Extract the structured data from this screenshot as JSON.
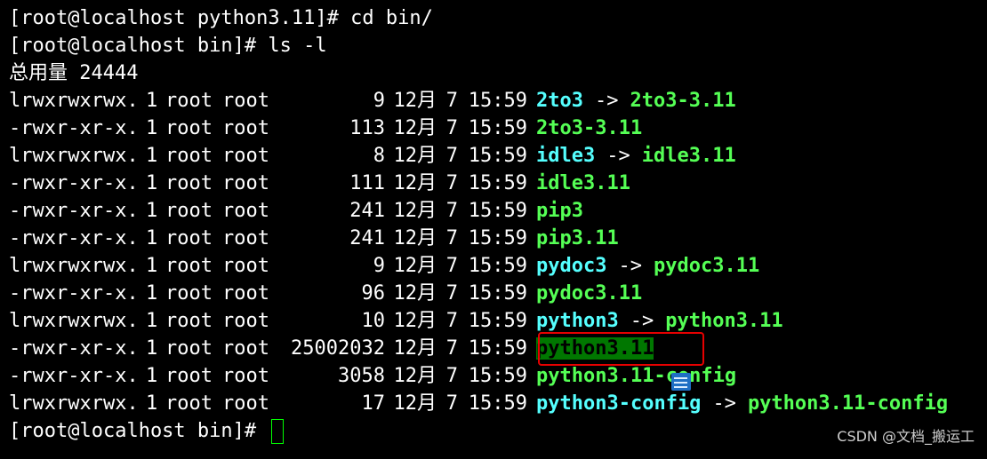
{
  "commands": [
    {
      "prompt": "[root@localhost python3.11]# ",
      "cmd": "cd bin/"
    },
    {
      "prompt": "[root@localhost bin]# ",
      "cmd": "ls -l"
    }
  ],
  "total_line": "总用量 24444",
  "entries": [
    {
      "perm": "lrwxrwxrwx.",
      "links": "1",
      "owner": "root",
      "group": "root",
      "size": "9",
      "month": "12月",
      "day": "7",
      "time": "15:59",
      "name": "2to3",
      "type": "symlink",
      "arrow": "->",
      "target": "2to3-3.11"
    },
    {
      "perm": "-rwxr-xr-x.",
      "links": "1",
      "owner": "root",
      "group": "root",
      "size": "113",
      "month": "12月",
      "day": "7",
      "time": "15:59",
      "name": "2to3-3.11",
      "type": "exec"
    },
    {
      "perm": "lrwxrwxrwx.",
      "links": "1",
      "owner": "root",
      "group": "root",
      "size": "8",
      "month": "12月",
      "day": "7",
      "time": "15:59",
      "name": "idle3",
      "type": "symlink",
      "arrow": "->",
      "target": "idle3.11"
    },
    {
      "perm": "-rwxr-xr-x.",
      "links": "1",
      "owner": "root",
      "group": "root",
      "size": "111",
      "month": "12月",
      "day": "7",
      "time": "15:59",
      "name": "idle3.11",
      "type": "exec"
    },
    {
      "perm": "-rwxr-xr-x.",
      "links": "1",
      "owner": "root",
      "group": "root",
      "size": "241",
      "month": "12月",
      "day": "7",
      "time": "15:59",
      "name": "pip3",
      "type": "exec"
    },
    {
      "perm": "-rwxr-xr-x.",
      "links": "1",
      "owner": "root",
      "group": "root",
      "size": "241",
      "month": "12月",
      "day": "7",
      "time": "15:59",
      "name": "pip3.11",
      "type": "exec"
    },
    {
      "perm": "lrwxrwxrwx.",
      "links": "1",
      "owner": "root",
      "group": "root",
      "size": "9",
      "month": "12月",
      "day": "7",
      "time": "15:59",
      "name": "pydoc3",
      "type": "symlink",
      "arrow": "->",
      "target": "pydoc3.11"
    },
    {
      "perm": "-rwxr-xr-x.",
      "links": "1",
      "owner": "root",
      "group": "root",
      "size": "96",
      "month": "12月",
      "day": "7",
      "time": "15:59",
      "name": "pydoc3.11",
      "type": "exec"
    },
    {
      "perm": "lrwxrwxrwx.",
      "links": "1",
      "owner": "root",
      "group": "root",
      "size": "10",
      "month": "12月",
      "day": "7",
      "time": "15:59",
      "name": "python3",
      "type": "symlink",
      "arrow": "->",
      "target": "python3.11"
    },
    {
      "perm": "-rwxr-xr-x.",
      "links": "1",
      "owner": "root",
      "group": "root",
      "size": "25002032",
      "month": "12月",
      "day": "7",
      "time": "15:59",
      "name": "python3.11",
      "type": "selected"
    },
    {
      "perm": "-rwxr-xr-x.",
      "links": "1",
      "owner": "root",
      "group": "root",
      "size": "3058",
      "month": "12月",
      "day": "7",
      "time": "15:59",
      "name": "python3.11-config",
      "type": "exec"
    },
    {
      "perm": "lrwxrwxrwx.",
      "links": "1",
      "owner": "root",
      "group": "root",
      "size": "17",
      "month": "12月",
      "day": "7",
      "time": "15:59",
      "name": "python3-config",
      "type": "symlink",
      "arrow": "->",
      "target": "python3.11-config"
    }
  ],
  "final_prompt": "[root@localhost bin]# ",
  "watermark": "CSDN @文档_搬运工",
  "colors": {
    "background": "#000000",
    "text": "#ffffff",
    "symlink": "#55ffff",
    "executable": "#55ff55",
    "selection": "#007700",
    "highlight_box": "#e60000",
    "cursor": "#00ff00"
  },
  "icons": {
    "overlay": "list-popup-icon"
  }
}
